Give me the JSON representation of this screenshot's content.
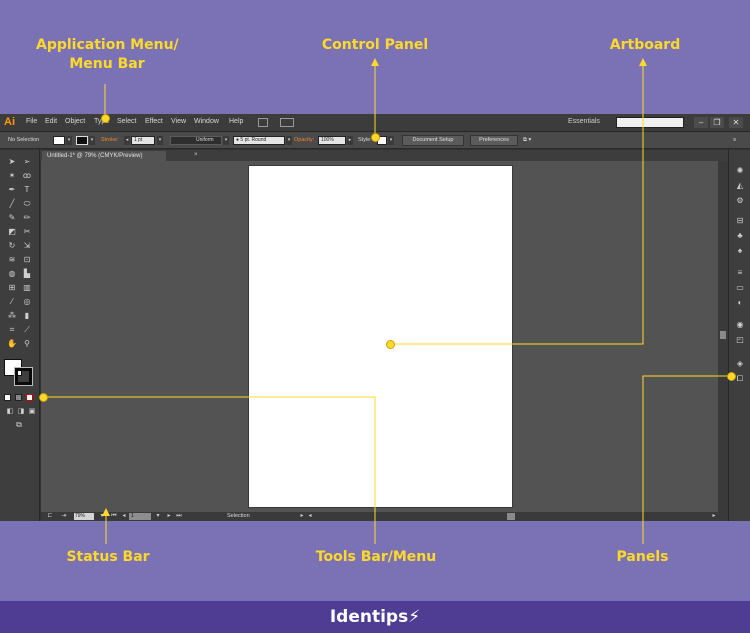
{
  "callouts": {
    "menu_line1": "Application Menu/",
    "menu_line2": "Menu Bar",
    "control_panel": "Control Panel",
    "artboard": "Artboard",
    "status_bar": "Status Bar",
    "tools": "Tools Bar/Menu",
    "panels": "Panels"
  },
  "app": {
    "logo": "Ai",
    "menu": [
      "File",
      "Edit",
      "Object",
      "Type",
      "Select",
      "Effect",
      "View",
      "Window",
      "Help"
    ],
    "workspace": "Essentials",
    "window_controls": [
      "–",
      "❐",
      "✕"
    ]
  },
  "control_panel": {
    "selection": "No Selection",
    "stroke_label": "Stroke:",
    "stroke_weight": "1 pt",
    "profile": "Uniform",
    "brush": "5 pt. Round",
    "opacity_label": "Opacity:",
    "opacity_value": "100%",
    "style_label": "Style:",
    "document_setup": "Document Setup",
    "preferences": "Preferences"
  },
  "document": {
    "tab_title": "Untitled-1* @ 79% (CMYK/Preview)",
    "tab_close": "×"
  },
  "status_bar": {
    "zoom": "79%",
    "page": "1",
    "label": "Selection"
  },
  "icons": {
    "tools": [
      "selection-arrow-icon",
      "direct-selection-icon",
      "magic-wand-icon",
      "lasso-icon",
      "pen-icon",
      "type-icon",
      "line-icon",
      "ellipse-icon",
      "paintbrush-icon",
      "pencil-icon",
      "eraser-icon",
      "scissors-icon",
      "rotate-icon",
      "scale-icon",
      "warp-icon",
      "free-transform-icon",
      "shape-builder-icon",
      "perspective-icon",
      "mesh-icon",
      "gradient-icon",
      "eyedropper-icon",
      "blend-icon",
      "symbol-sprayer-icon",
      "graph-icon",
      "artboard-tool-icon",
      "slice-icon",
      "hand-icon",
      "zoom-icon"
    ],
    "dock": [
      "color-icon",
      "color-guide-icon",
      "swatches-icon",
      "brushes-icon",
      "symbols-icon",
      "graphic-styles-icon",
      "stroke-icon",
      "gradient-panel-icon",
      "transparency-icon",
      "appearance-icon",
      "layers-icon",
      "artboards-panel-icon"
    ]
  },
  "brand": {
    "name": "Identips",
    "mark": "⚡"
  },
  "colors": {
    "background": "#7b72b6",
    "callout": "#ffd92a",
    "footer": "#4e3d93",
    "logo": "#ff9a00"
  }
}
